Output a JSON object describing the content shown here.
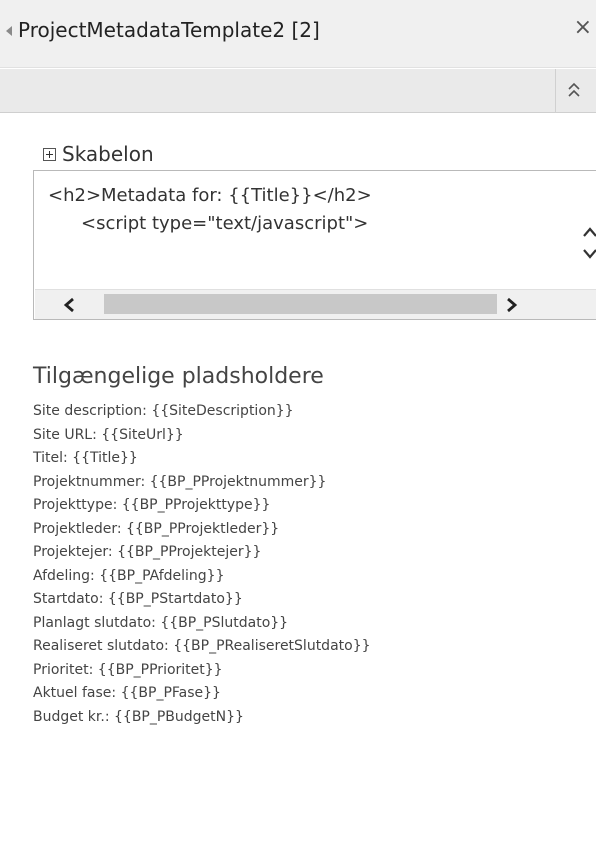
{
  "panel": {
    "title": "ProjectMetadataTemplate2 [2]"
  },
  "icons": {
    "collapse_left": "triangle-left-icon",
    "close": "close-icon",
    "collapse_toolbar": "double-chevron-up-icon",
    "expand": "plus-box-icon",
    "scroll_up": "chevron-up-icon",
    "scroll_down": "chevron-down-icon",
    "scroll_left": "chevron-left-icon",
    "scroll_right": "chevron-right-icon"
  },
  "template_section": {
    "label": "Skabelon",
    "code_lines": [
      "<h2>Metadata for: {{Title}}</h2>",
      "<script type=\"text/javascript\">"
    ]
  },
  "placeholders": {
    "heading": "Tilgængelige pladsholdere",
    "items": [
      "Site description: {{SiteDescription}}",
      "Site URL: {{SiteUrl}}",
      "Titel: {{Title}}",
      "Projektnummer: {{BP_PProjektnummer}}",
      "Projekttype: {{BP_PProjekttype}}",
      "Projektleder: {{BP_PProjektleder}}",
      "Projektejer: {{BP_PProjektejer}}",
      "Afdeling: {{BP_PAfdeling}}",
      "Startdato: {{BP_PStartdato}}",
      "Planlagt slutdato: {{BP_PSlutdato}}",
      "Realiseret slutdato: {{BP_PRealiseretSlutdato}}",
      "Prioritet: {{BP_PPrioritet}}",
      "Aktuel fase: {{BP_PFase}}",
      "Budget kr.: {{BP_PBudgetN}}"
    ]
  }
}
